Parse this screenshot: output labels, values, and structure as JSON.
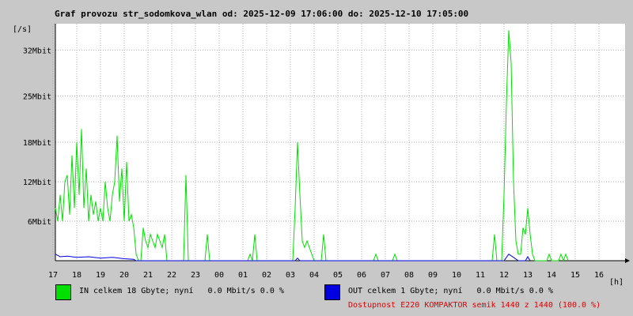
{
  "chart_data": {
    "type": "line",
    "title": "Graf provozu str_sodomkova_wlan od: 2025-12-09 17:06:00 do: 2025-12-10 17:05:00",
    "ylabel": "[/s]",
    "xlabel": "[h]",
    "x_ticks": [
      "18",
      "19",
      "20",
      "21",
      "22",
      "23",
      "00",
      "01",
      "02",
      "03",
      "04",
      "05",
      "06",
      "07",
      "08",
      "09",
      "10",
      "11",
      "12",
      "13",
      "14",
      "15",
      "16",
      "17"
    ],
    "y_ticks": [
      {
        "value": 6,
        "label": "6Mbit"
      },
      {
        "value": 12,
        "label": "12Mbit"
      },
      {
        "value": 18,
        "label": "18Mbit"
      },
      {
        "value": 25,
        "label": "25Mbit"
      },
      {
        "value": 32,
        "label": "32Mbit"
      }
    ],
    "xlim": [
      17.1,
      41.1
    ],
    "ylim": [
      0,
      36
    ],
    "grid": true,
    "series": [
      {
        "name": "IN",
        "color": "#00e000",
        "points": [
          [
            17.1,
            8
          ],
          [
            17.2,
            6
          ],
          [
            17.3,
            10
          ],
          [
            17.4,
            6
          ],
          [
            17.5,
            12
          ],
          [
            17.6,
            13
          ],
          [
            17.7,
            7
          ],
          [
            17.8,
            16
          ],
          [
            17.9,
            8
          ],
          [
            18.0,
            18
          ],
          [
            18.1,
            10
          ],
          [
            18.2,
            20
          ],
          [
            18.3,
            8
          ],
          [
            18.4,
            14
          ],
          [
            18.5,
            6
          ],
          [
            18.6,
            10
          ],
          [
            18.7,
            7
          ],
          [
            18.8,
            9
          ],
          [
            18.9,
            6
          ],
          [
            19.0,
            8
          ],
          [
            19.1,
            6
          ],
          [
            19.2,
            12
          ],
          [
            19.3,
            8
          ],
          [
            19.4,
            6
          ],
          [
            19.5,
            10
          ],
          [
            19.6,
            12
          ],
          [
            19.7,
            19
          ],
          [
            19.8,
            9
          ],
          [
            19.9,
            14
          ],
          [
            20.0,
            6
          ],
          [
            20.1,
            15
          ],
          [
            20.2,
            6
          ],
          [
            20.3,
            7
          ],
          [
            20.4,
            5
          ],
          [
            20.5,
            1
          ],
          [
            20.6,
            0
          ],
          [
            20.7,
            0
          ],
          [
            20.8,
            5
          ],
          [
            20.9,
            3
          ],
          [
            21.0,
            2
          ],
          [
            21.1,
            4
          ],
          [
            21.2,
            3
          ],
          [
            21.3,
            2
          ],
          [
            21.4,
            4
          ],
          [
            21.5,
            3
          ],
          [
            21.6,
            2
          ],
          [
            21.7,
            4
          ],
          [
            21.8,
            0
          ],
          [
            22.5,
            0
          ],
          [
            22.6,
            13
          ],
          [
            22.7,
            0
          ],
          [
            23.4,
            0
          ],
          [
            23.5,
            4
          ],
          [
            23.6,
            0
          ],
          [
            25.2,
            0
          ],
          [
            25.3,
            1
          ],
          [
            25.4,
            0
          ],
          [
            25.5,
            4
          ],
          [
            25.6,
            0
          ],
          [
            27.1,
            0
          ],
          [
            27.2,
            8
          ],
          [
            27.3,
            18
          ],
          [
            27.4,
            10
          ],
          [
            27.5,
            3
          ],
          [
            27.6,
            2
          ],
          [
            27.7,
            3
          ],
          [
            27.8,
            2
          ],
          [
            27.9,
            1
          ],
          [
            28.0,
            0
          ],
          [
            28.3,
            0
          ],
          [
            28.4,
            4
          ],
          [
            28.5,
            0
          ],
          [
            30.5,
            0
          ],
          [
            30.6,
            1
          ],
          [
            30.7,
            0
          ],
          [
            31.3,
            0
          ],
          [
            31.4,
            1
          ],
          [
            31.5,
            0
          ],
          [
            35.5,
            0
          ],
          [
            35.6,
            4
          ],
          [
            35.7,
            0
          ],
          [
            35.9,
            0
          ],
          [
            36.0,
            10
          ],
          [
            36.1,
            24
          ],
          [
            36.2,
            35
          ],
          [
            36.3,
            30
          ],
          [
            36.4,
            12
          ],
          [
            36.5,
            3
          ],
          [
            36.6,
            1
          ],
          [
            36.7,
            1
          ],
          [
            36.8,
            5
          ],
          [
            36.9,
            4
          ],
          [
            37.0,
            8
          ],
          [
            37.1,
            4
          ],
          [
            37.2,
            1
          ],
          [
            37.3,
            0
          ],
          [
            37.8,
            0
          ],
          [
            37.9,
            1
          ],
          [
            38.0,
            0
          ],
          [
            38.3,
            0
          ],
          [
            38.4,
            1
          ],
          [
            38.5,
            0
          ],
          [
            38.6,
            1
          ],
          [
            38.7,
            0
          ]
        ]
      },
      {
        "name": "OUT",
        "color": "#0000e0",
        "points": [
          [
            17.1,
            1
          ],
          [
            17.3,
            0.6
          ],
          [
            17.6,
            0.7
          ],
          [
            18.0,
            0.5
          ],
          [
            18.5,
            0.6
          ],
          [
            19.0,
            0.4
          ],
          [
            19.5,
            0.5
          ],
          [
            20.0,
            0.3
          ],
          [
            20.4,
            0.2
          ],
          [
            20.5,
            0
          ],
          [
            27.2,
            0
          ],
          [
            27.3,
            0.4
          ],
          [
            27.4,
            0
          ],
          [
            36.0,
            0
          ],
          [
            36.2,
            1
          ],
          [
            36.4,
            0.5
          ],
          [
            36.6,
            0
          ],
          [
            36.9,
            0
          ],
          [
            37.0,
            0.6
          ],
          [
            37.1,
            0
          ]
        ]
      }
    ]
  },
  "legend": {
    "in": {
      "text": "IN celkem 18 Gbyte; nyní   0.0 Mbit/s 0.0 %",
      "color": "#00e000"
    },
    "out": {
      "text": "OUT celkem 1 Gbyte; nyní   0.0 Mbit/s 0.0 %",
      "color": "#0000e0"
    }
  },
  "availability": {
    "text": "Dostupnost E220 KOMPAKTOR semik 1440 z 1440 (100.0 %)",
    "color": "#e00000"
  }
}
